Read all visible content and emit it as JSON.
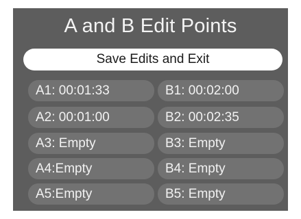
{
  "title": "A and B Edit Points",
  "save_button": {
    "label": "Save Edits and Exit"
  },
  "a_points": [
    {
      "label": "A1: 00:01:33"
    },
    {
      "label": "A2: 00:01:00"
    },
    {
      "label": "A3: Empty"
    },
    {
      "label": "A4:Empty"
    },
    {
      "label": "A5:Empty"
    }
  ],
  "b_points": [
    {
      "label": "B1: 00:02:00"
    },
    {
      "label": "B2: 00:02:35"
    },
    {
      "label": "B3: Empty"
    },
    {
      "label": "B4: Empty"
    },
    {
      "label": "B5: Empty"
    }
  ],
  "colors": {
    "panel": "#5d5d5d",
    "slot": "#727272",
    "button": "#ffffff",
    "text": "#f2f2f2"
  }
}
